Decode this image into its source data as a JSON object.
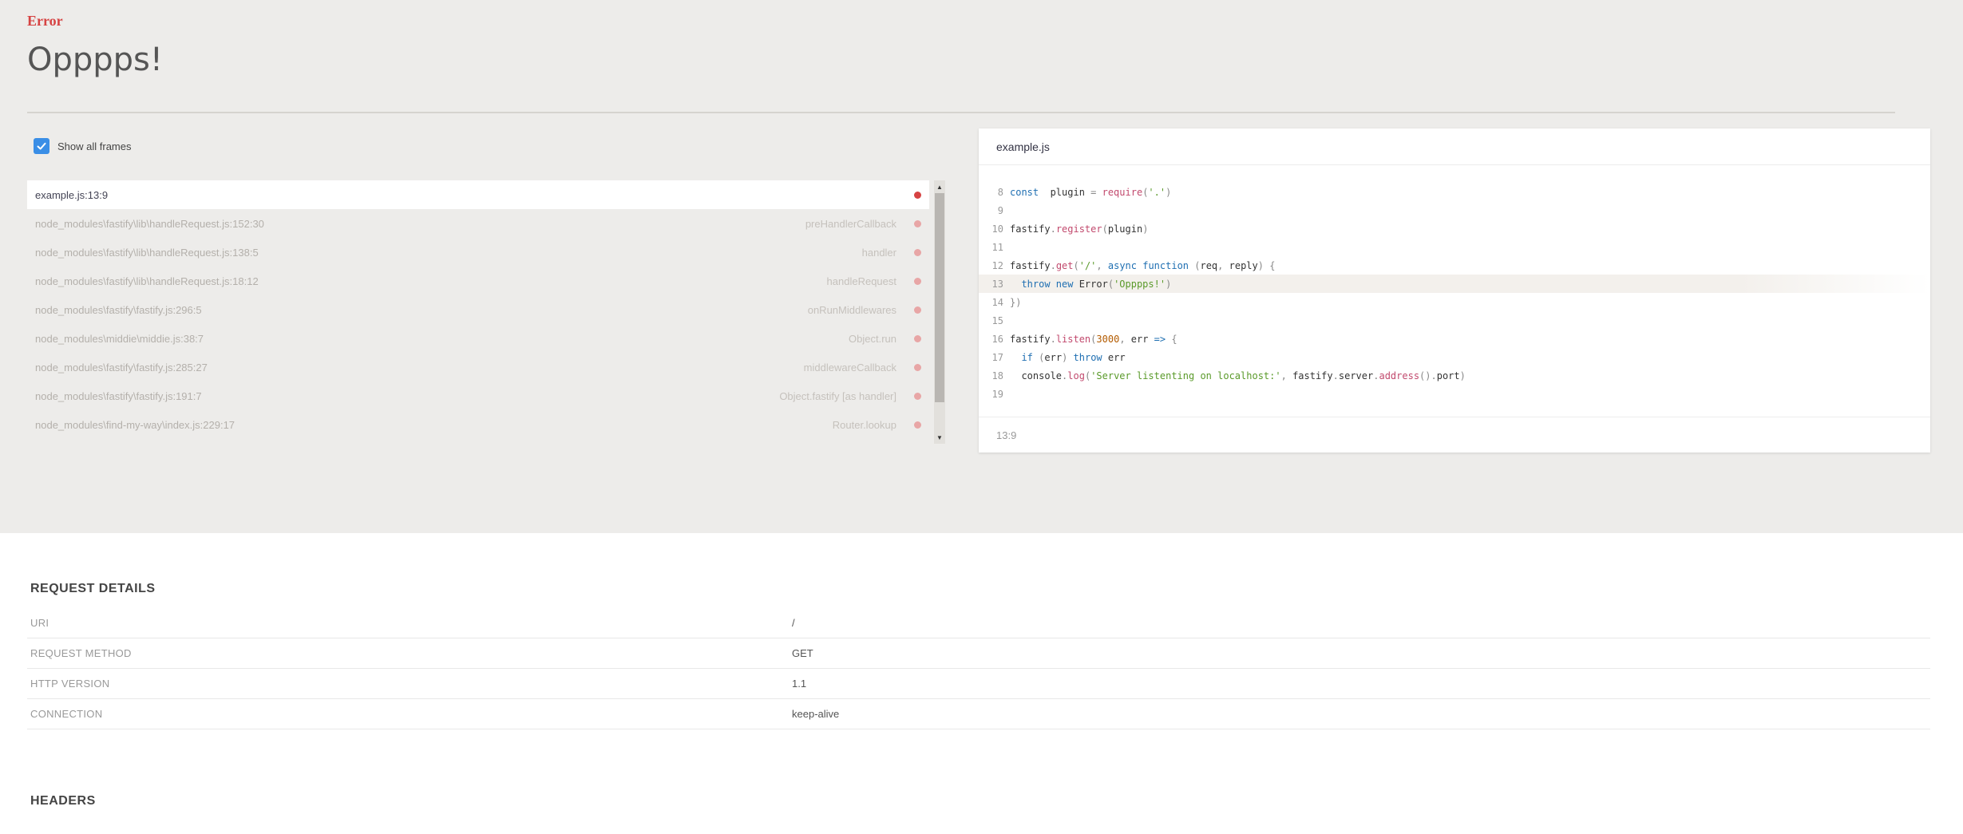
{
  "error": {
    "type": "Error",
    "message": "Opppps!"
  },
  "frames_panel": {
    "show_all_label": "Show all frames",
    "show_all_checked": true,
    "frames": [
      {
        "file": "example.js:13:9",
        "fn": "",
        "active": true
      },
      {
        "file": "node_modules\\fastify\\lib\\handleRequest.js:152:30",
        "fn": "preHandlerCallback",
        "active": false
      },
      {
        "file": "node_modules\\fastify\\lib\\handleRequest.js:138:5",
        "fn": "handler",
        "active": false
      },
      {
        "file": "node_modules\\fastify\\lib\\handleRequest.js:18:12",
        "fn": "handleRequest",
        "active": false
      },
      {
        "file": "node_modules\\fastify\\fastify.js:296:5",
        "fn": "onRunMiddlewares",
        "active": false
      },
      {
        "file": "node_modules\\middie\\middie.js:38:7",
        "fn": "Object.run",
        "active": false
      },
      {
        "file": "node_modules\\fastify\\fastify.js:285:27",
        "fn": "middlewareCallback",
        "active": false
      },
      {
        "file": "node_modules\\fastify\\fastify.js:191:7",
        "fn": "Object.fastify [as handler]",
        "active": false
      },
      {
        "file": "node_modules\\find-my-way\\index.js:229:17",
        "fn": "Router.lookup",
        "active": false
      }
    ]
  },
  "code_panel": {
    "filename": "example.js",
    "position": "13:9",
    "lines": [
      {
        "n": "8",
        "tokens": [
          [
            "kw",
            "const"
          ],
          [
            "",
            "  plugin "
          ],
          [
            "pun",
            "= "
          ],
          [
            "fnc",
            "require"
          ],
          [
            "pun",
            "("
          ],
          [
            "str",
            "'.'"
          ],
          [
            "pun",
            ")"
          ]
        ]
      },
      {
        "n": "9",
        "tokens": []
      },
      {
        "n": "10",
        "tokens": [
          [
            "",
            "fastify"
          ],
          [
            "pun",
            "."
          ],
          [
            "fnc",
            "register"
          ],
          [
            "pun",
            "("
          ],
          [
            "",
            "plugin"
          ],
          [
            "pun",
            ")"
          ]
        ]
      },
      {
        "n": "11",
        "tokens": []
      },
      {
        "n": "12",
        "tokens": [
          [
            "",
            "fastify"
          ],
          [
            "pun",
            "."
          ],
          [
            "fnc",
            "get"
          ],
          [
            "pun",
            "("
          ],
          [
            "str",
            "'/'"
          ],
          [
            "pun",
            ", "
          ],
          [
            "kw",
            "async function "
          ],
          [
            "pun",
            "("
          ],
          [
            "",
            "req"
          ],
          [
            "pun",
            ", "
          ],
          [
            "",
            "reply"
          ],
          [
            "pun",
            ") {"
          ]
        ]
      },
      {
        "n": "13",
        "hl": true,
        "tokens": [
          [
            "",
            "  "
          ],
          [
            "kw",
            "throw new "
          ],
          [
            "",
            "Error"
          ],
          [
            "pun",
            "("
          ],
          [
            "str",
            "'Opppps!'"
          ],
          [
            "pun",
            ")"
          ]
        ]
      },
      {
        "n": "14",
        "tokens": [
          [
            "pun",
            "})"
          ]
        ]
      },
      {
        "n": "15",
        "tokens": []
      },
      {
        "n": "16",
        "tokens": [
          [
            "",
            "fastify"
          ],
          [
            "pun",
            "."
          ],
          [
            "fnc",
            "listen"
          ],
          [
            "pun",
            "("
          ],
          [
            "num",
            "3000"
          ],
          [
            "pun",
            ", "
          ],
          [
            "",
            "err "
          ],
          [
            "kw",
            "=> "
          ],
          [
            "pun",
            "{"
          ]
        ]
      },
      {
        "n": "17",
        "tokens": [
          [
            "",
            "  "
          ],
          [
            "kw",
            "if "
          ],
          [
            "pun",
            "("
          ],
          [
            "",
            "err"
          ],
          [
            "pun",
            ") "
          ],
          [
            "kw",
            "throw "
          ],
          [
            "",
            "err"
          ]
        ]
      },
      {
        "n": "18",
        "tokens": [
          [
            "",
            "  console"
          ],
          [
            "pun",
            "."
          ],
          [
            "fnc",
            "log"
          ],
          [
            "pun",
            "("
          ],
          [
            "str",
            "'Server listenting on localhost:'"
          ],
          [
            "pun",
            ", "
          ],
          [
            "",
            "fastify"
          ],
          [
            "pun",
            "."
          ],
          [
            "",
            "server"
          ],
          [
            "pun",
            "."
          ],
          [
            "fnc",
            "address"
          ],
          [
            "pun",
            "()."
          ],
          [
            "",
            "port"
          ],
          [
            "pun",
            ")"
          ]
        ]
      },
      {
        "n": "19",
        "tokens": []
      }
    ]
  },
  "request_details": {
    "title": "REQUEST DETAILS",
    "rows": [
      {
        "key": "URI",
        "value": "/"
      },
      {
        "key": "REQUEST METHOD",
        "value": "GET"
      },
      {
        "key": "HTTP VERSION",
        "value": "1.1"
      },
      {
        "key": "CONNECTION",
        "value": "keep-alive"
      }
    ]
  },
  "headers": {
    "title": "HEADERS"
  },
  "colors": {
    "accent_red": "#d64343",
    "checkbox_blue": "#3a8ee6",
    "top_background": "#edecea"
  }
}
